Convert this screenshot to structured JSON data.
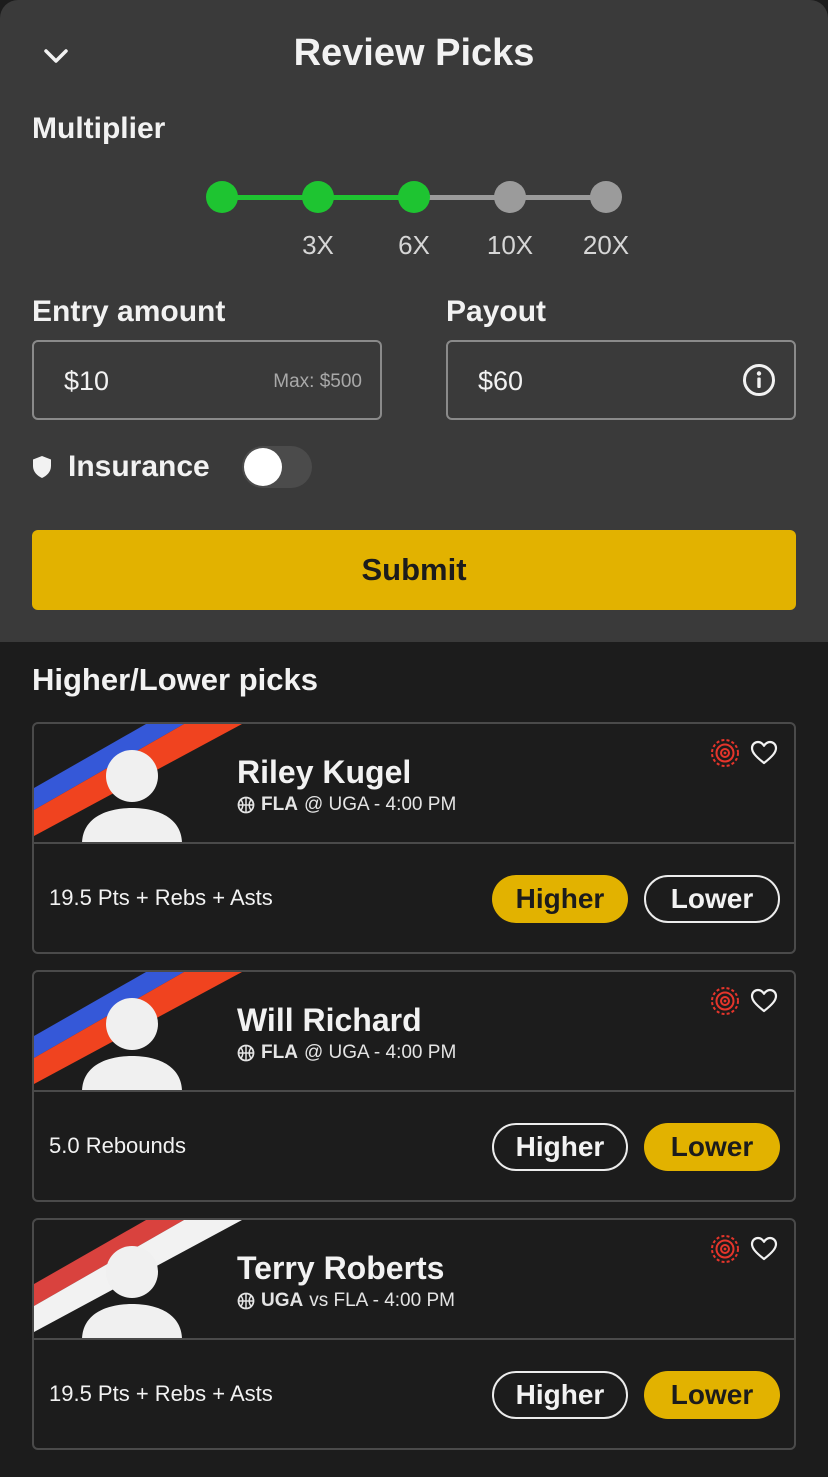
{
  "header": {
    "title": "Review Picks"
  },
  "multiplier": {
    "label": "Multiplier",
    "steps": [
      "",
      "3X",
      "6X",
      "10X",
      "20X"
    ],
    "selected": "6X"
  },
  "entry": {
    "label": "Entry amount",
    "value": "$10",
    "max": "Max: $500"
  },
  "payout": {
    "label": "Payout",
    "value": "$60"
  },
  "insurance": {
    "label": "Insurance",
    "enabled": false
  },
  "submit_label": "Submit",
  "picks_title": "Higher/Lower picks",
  "picks": [
    {
      "name": "Riley Kugel",
      "team": "FLA",
      "matchup": "@ UGA - 4:00 PM",
      "stat": "19.5 Pts + Rebs + Asts",
      "higher": "Higher",
      "lower": "Lower",
      "selection": "Higher",
      "colors": [
        "#3558d8",
        "#f0431f"
      ]
    },
    {
      "name": "Will Richard",
      "team": "FLA",
      "matchup": "@ UGA - 4:00 PM",
      "stat": "5.0 Rebounds",
      "higher": "Higher",
      "lower": "Lower",
      "selection": "Lower",
      "colors": [
        "#3558d8",
        "#f0431f"
      ]
    },
    {
      "name": "Terry Roberts",
      "team": "UGA",
      "matchup": "vs FLA - 4:00 PM",
      "stat": "19.5 Pts + Rebs + Asts",
      "higher": "Higher",
      "lower": "Lower",
      "selection": "Lower",
      "colors": [
        "#d9423e",
        "#f2f2f2"
      ]
    }
  ],
  "colors": {
    "accent": "#e2b200",
    "active": "#1ec431",
    "inactive": "#9b9b9b",
    "sheet": "#3a3a3a",
    "background": "#1c1c1c"
  }
}
